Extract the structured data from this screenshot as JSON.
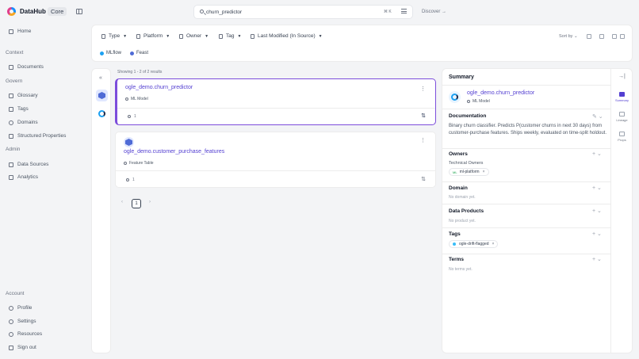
{
  "app": {
    "title": "DataHub",
    "edition": "Core"
  },
  "search": {
    "value": "churn_predictor",
    "shortcut": "⌘ K",
    "discover": "Discover"
  },
  "sidebar": {
    "home": "Home",
    "context_header": "Context",
    "documents": "Documents",
    "govern_header": "Govern",
    "glossary": "Glossary",
    "tags": "Tags",
    "domains": "Domains",
    "structured_properties": "Structured Properties",
    "admin_header": "Admin",
    "data_sources": "Data Sources",
    "analytics": "Analytics",
    "account_header": "Account",
    "profile": "Profile",
    "settings": "Settings",
    "resources": "Resources",
    "sign_out": "Sign out"
  },
  "filters": {
    "type": "Type",
    "platform": "Platform",
    "owner": "Owner",
    "tag": "Tag",
    "last_modified": "Last Modified (In Source)",
    "sort_by": "Sort by",
    "chips": [
      "MLflow",
      "Feast"
    ]
  },
  "results": {
    "summary": "Showing 1 - 2 of 2 results",
    "items": [
      {
        "title": "ogle_demo.churn_predictor",
        "type": "ML Model",
        "count": "1"
      },
      {
        "title": "ogle_demo.customer_purchase_features",
        "type": "Feature Table",
        "count": "1"
      }
    ],
    "page": "1"
  },
  "panel": {
    "header": "Summary",
    "entity_name": "ogle_demo.churn_predictor",
    "entity_type": "ML Model",
    "documentation_title": "Documentation",
    "documentation": "Binary churn classifier. Predicts P(customer churns in next 30 days) from customer-purchase features. Ships weekly, evaluated on time-split holdout.",
    "owners_title": "Owners",
    "owners_sub": "Technical Owners",
    "owner_ml": "ML",
    "owner_name": "ml-platform",
    "domain_title": "Domain",
    "domain_empty": "No domain yet.",
    "products_title": "Data Products",
    "products_empty": "No product yet.",
    "tags_title": "Tags",
    "tag_name": "ogle-drift-flagged",
    "terms_title": "Terms",
    "terms_empty": "No terms yet."
  },
  "tabs": {
    "summary": "Summary",
    "lineage": "Lineage",
    "props": "Props"
  },
  "colors": {
    "accent": "#533fd1",
    "selected_border": "#7c4ddb"
  }
}
